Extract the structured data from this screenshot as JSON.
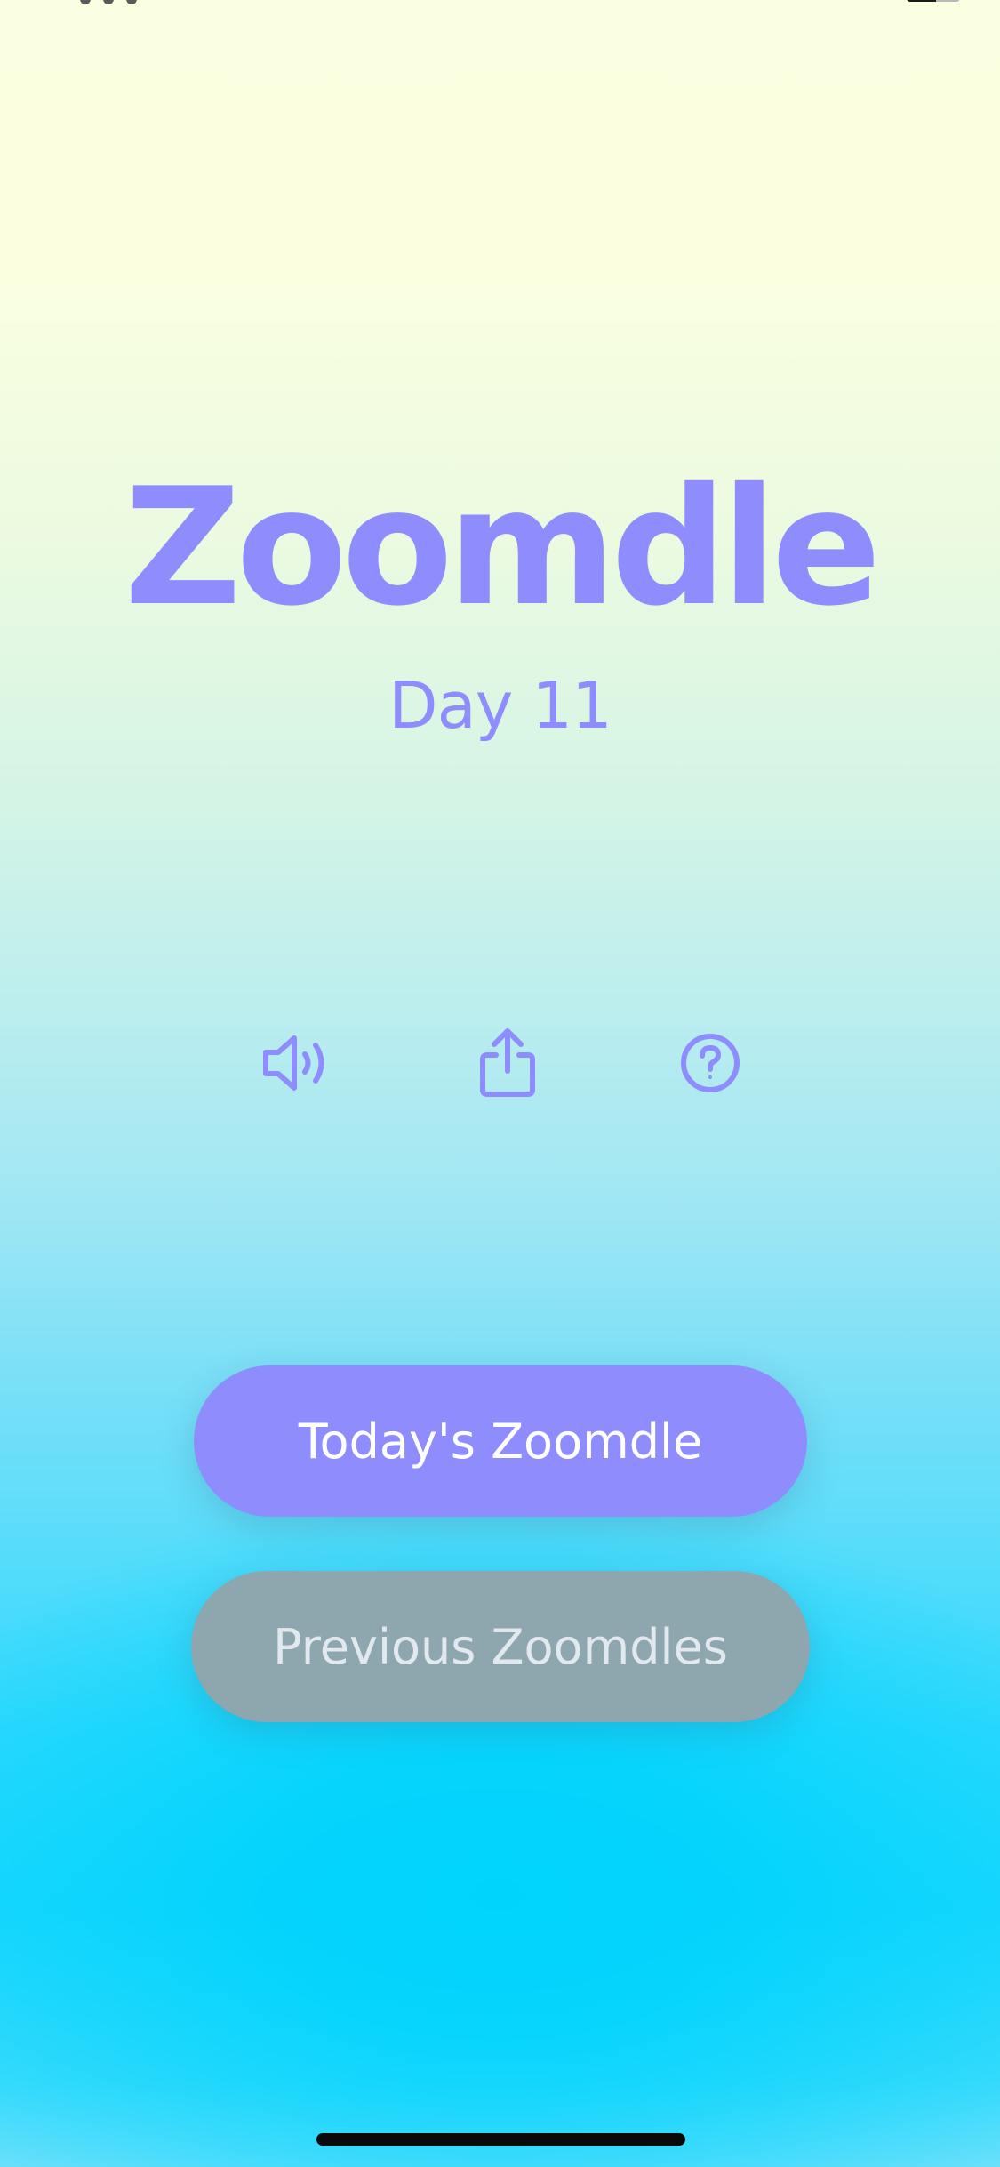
{
  "app": {
    "title": "Zoomdle",
    "day_label": "Day 11"
  },
  "icons": [
    {
      "name": "sound-icon"
    },
    {
      "name": "share-icon"
    },
    {
      "name": "help-icon"
    }
  ],
  "buttons": {
    "primary_label": "Today's Zoomdle",
    "secondary_label": "Previous Zoomdles"
  },
  "colors": {
    "accent": "#8f8cfd",
    "secondary_button": "#8ea6ad",
    "background_top": "#fbffe0",
    "background_bottom": "#00d4fd"
  }
}
